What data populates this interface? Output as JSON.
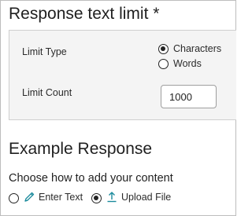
{
  "limit_section": {
    "title": "Response text limit *",
    "limit_type": {
      "label": "Limit Type",
      "options": [
        {
          "label": "Characters",
          "selected": true
        },
        {
          "label": "Words",
          "selected": false
        }
      ]
    },
    "limit_count": {
      "label": "Limit Count",
      "value": "1000"
    }
  },
  "example_section": {
    "title": "Example Response",
    "prompt": "Choose how to add your content",
    "options": [
      {
        "label": "Enter Text",
        "icon": "pencil-icon",
        "selected": false
      },
      {
        "label": "Upload File",
        "icon": "upload-icon",
        "selected": true
      }
    ]
  },
  "colors": {
    "icon_accent": "#1a8a9c",
    "panel_bg": "#f4f4f4"
  }
}
